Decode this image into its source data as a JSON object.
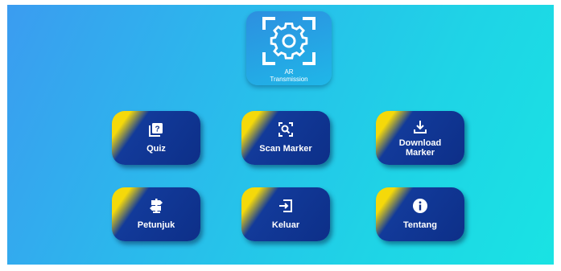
{
  "app": {
    "logo_line1": "AR",
    "logo_line2": "Transmission"
  },
  "menu": {
    "quiz": "Quiz",
    "scan_marker": "Scan Marker",
    "download_line1": "Download",
    "download_line2": "Marker",
    "petunjuk": "Petunjuk",
    "keluar": "Keluar",
    "tentang": "Tentang"
  },
  "icons": {
    "logo": "gear-scan-icon",
    "quiz": "quiz-icon",
    "scan_marker": "scan-search-icon",
    "download_marker": "download-icon",
    "petunjuk": "signpost-icon",
    "keluar": "exit-icon",
    "tentang": "info-icon"
  },
  "colors": {
    "button_bg": "#0d2f88",
    "button_accent": "#f5d90a",
    "background_start": "#3b9cf0",
    "background_end": "#19e3e3"
  }
}
